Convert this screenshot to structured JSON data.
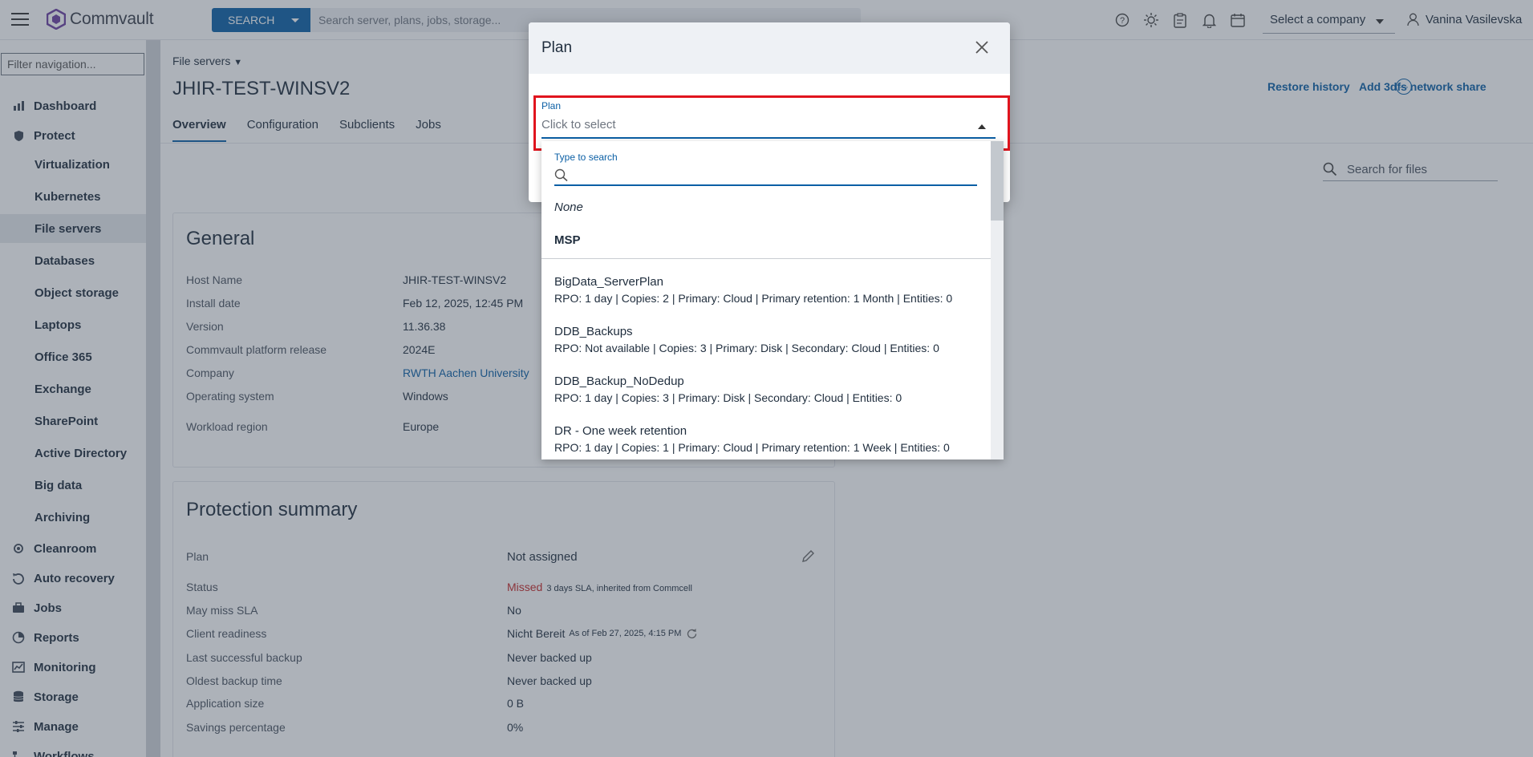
{
  "topbar": {
    "logo_text": "Commvault",
    "search_button": "SEARCH",
    "search_placeholder": "Search server, plans, jobs, storage...",
    "company_select": "Select a company",
    "user_name": "Vanina Vasilevska"
  },
  "nav": {
    "filter_placeholder": "Filter navigation...",
    "items": [
      {
        "label": "Dashboard",
        "icon": "dashboard-icon"
      },
      {
        "label": "Protect",
        "icon": "shield-icon"
      },
      {
        "label": "Virtualization"
      },
      {
        "label": "Kubernetes"
      },
      {
        "label": "File servers",
        "active": true
      },
      {
        "label": "Databases"
      },
      {
        "label": "Object storage"
      },
      {
        "label": "Laptops"
      },
      {
        "label": "Office 365"
      },
      {
        "label": "Exchange"
      },
      {
        "label": "SharePoint"
      },
      {
        "label": "Active Directory"
      },
      {
        "label": "Big data"
      },
      {
        "label": "Archiving"
      },
      {
        "label": "Cleanroom",
        "icon": "cleanroom-icon"
      },
      {
        "label": "Auto recovery",
        "icon": "auto-recovery-icon"
      },
      {
        "label": "Jobs",
        "icon": "briefcase-icon"
      },
      {
        "label": "Reports",
        "icon": "reports-icon"
      },
      {
        "label": "Monitoring",
        "icon": "monitoring-icon"
      },
      {
        "label": "Storage",
        "icon": "database-icon"
      },
      {
        "label": "Manage",
        "icon": "sliders-icon"
      },
      {
        "label": "Workflows",
        "icon": "workflow-icon"
      }
    ]
  },
  "page": {
    "breadcrumb": "File servers",
    "title": "JHIR-TEST-WINSV2",
    "tabs": [
      "Overview",
      "Configuration",
      "Subclients",
      "Jobs"
    ],
    "restore_history": "Restore history",
    "add_share": "Add 3dfs network share",
    "file_search_placeholder": "Search for files"
  },
  "general": {
    "heading": "General",
    "rows": [
      {
        "key": "Host Name",
        "value": "JHIR-TEST-WINSV2"
      },
      {
        "key": "Install date",
        "value": "Feb 12, 2025, 12:45 PM"
      },
      {
        "key": "Version",
        "value": "11.36.38"
      },
      {
        "key": "Commvault platform release",
        "value": "2024E"
      },
      {
        "key": "Company",
        "value": "RWTH Aachen University"
      },
      {
        "key": "Operating system",
        "value": "Windows"
      },
      {
        "key": "Workload region",
        "value": "Europe"
      }
    ]
  },
  "protection": {
    "heading": "Protection summary",
    "plan_key": "Plan",
    "plan_value": "Not assigned",
    "status_key": "Status",
    "status_value": "Missed",
    "status_note": "3 days SLA, inherited from Commcell",
    "miss_key": "May miss SLA",
    "miss_value": "No",
    "readiness_key": "Client readiness",
    "readiness_value": "Nicht Bereit",
    "readiness_note": "As of Feb 27, 2025, 4:15 PM",
    "last_key": "Last successful backup",
    "last_value": "Never backed up",
    "oldest_key": "Oldest backup time",
    "oldest_value": "Never backed up",
    "appsize_key": "Application size",
    "appsize_value": "0 B",
    "savings_key": "Savings percentage",
    "savings_value": "0%"
  },
  "modal": {
    "title": "Plan",
    "field_label": "Plan",
    "field_placeholder": "Click to select",
    "search_label": "Type to search",
    "none_option": "None",
    "msp_option": "MSP",
    "plans": [
      {
        "name": "BigData_ServerPlan",
        "desc": "RPO: 1 day | Copies: 2 | Primary: Cloud | Primary retention: 1 Month | Entities: 0"
      },
      {
        "name": "DDB_Backups",
        "desc": "RPO: Not available | Copies: 3 | Primary: Disk | Secondary: Cloud | Entities: 0"
      },
      {
        "name": "DDB_Backup_NoDedup",
        "desc": "RPO: 1 day | Copies: 3 | Primary: Disk | Secondary: Cloud | Entities: 0"
      },
      {
        "name": "DR - One week retention",
        "desc": "RPO: 1 day | Copies: 1 | Primary: Cloud | Primary retention: 1 Week | Entities: 0"
      }
    ]
  }
}
